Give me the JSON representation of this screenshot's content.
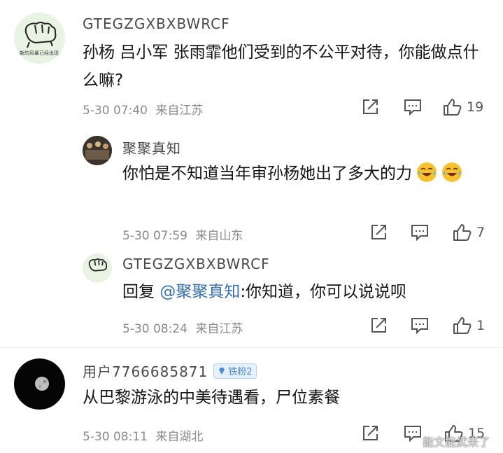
{
  "comments": [
    {
      "username": "GTEGZGXBXBWRCF",
      "avatar_caption": "新的风暴已经出现",
      "text": "孙杨 吕小军 张雨霏他们受到的不公平对待，你能做点什么嘛?",
      "time": "5-30 07:40",
      "location": "来自江苏",
      "likes": "19",
      "replies": [
        {
          "username": "聚聚真知",
          "text": "你怕是不知道当年审孙杨她出了多大的力",
          "emoji": "laughing-crying-emoji",
          "time": "5-30 07:59",
          "location": "来自山东",
          "likes": "7"
        },
        {
          "username": "GTEGZGXBXBWRCF",
          "reply_prefix": "回复 ",
          "mention": "@聚聚真知",
          "text": ":你知道，你可以说说呗",
          "time": "5-30 08:24",
          "location": "来自江苏",
          "likes": "1"
        }
      ]
    },
    {
      "username": "用户7766685871",
      "badge": "铁粉2",
      "text": "从巴黎游泳的中美待遇看，尸位素餐",
      "time": "5-30 08:11",
      "location": "来自湖北",
      "likes": "15"
    }
  ],
  "watermark": "能文能武来了",
  "icons": [
    "share-icon",
    "comment-icon",
    "like-icon",
    "diamond-icon"
  ]
}
